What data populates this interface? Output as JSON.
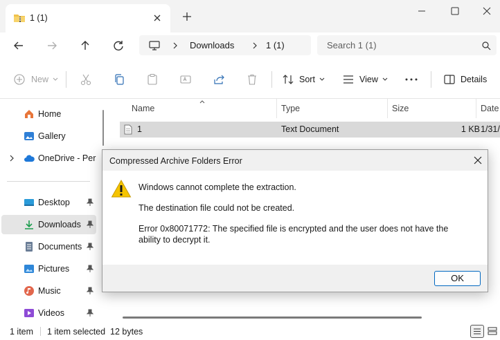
{
  "tab": {
    "title": "1 (1)",
    "new_tab": "+"
  },
  "address": {
    "location_1": "Downloads",
    "location_2": "1 (1)"
  },
  "search": {
    "text": "Search 1 (1)"
  },
  "toolbar": {
    "new_label": "New",
    "sort_label": "Sort",
    "view_label": "View",
    "details_label": "Details"
  },
  "sidebar": {
    "items": [
      {
        "label": "Home"
      },
      {
        "label": "Gallery"
      },
      {
        "label": "OneDrive - Perso"
      },
      {
        "label": "Desktop"
      },
      {
        "label": "Downloads"
      },
      {
        "label": "Documents"
      },
      {
        "label": "Pictures"
      },
      {
        "label": "Music"
      },
      {
        "label": "Videos"
      }
    ]
  },
  "filelist": {
    "columns": [
      "Name",
      "Type",
      "Size",
      "Date"
    ],
    "rows": [
      {
        "name": "1",
        "type": "Text Document",
        "size": "1 KB",
        "date": "1/31/"
      }
    ]
  },
  "status": {
    "count": "1 item",
    "selection": "1 item selected  12 bytes"
  },
  "dialog": {
    "title": "Compressed Archive Folders Error",
    "message1": "Windows cannot complete the extraction.",
    "message2": "The destination file could not be created.",
    "message3": "Error 0x80071772: The specified file is encrypted and the user does not have the ability to decrypt it.",
    "ok_label": "OK"
  },
  "colors": {
    "accent": "#0067c0",
    "selected_bg": "#e5e5e5",
    "row_selected": "#d9d9d9",
    "warning": "#f5c400"
  }
}
